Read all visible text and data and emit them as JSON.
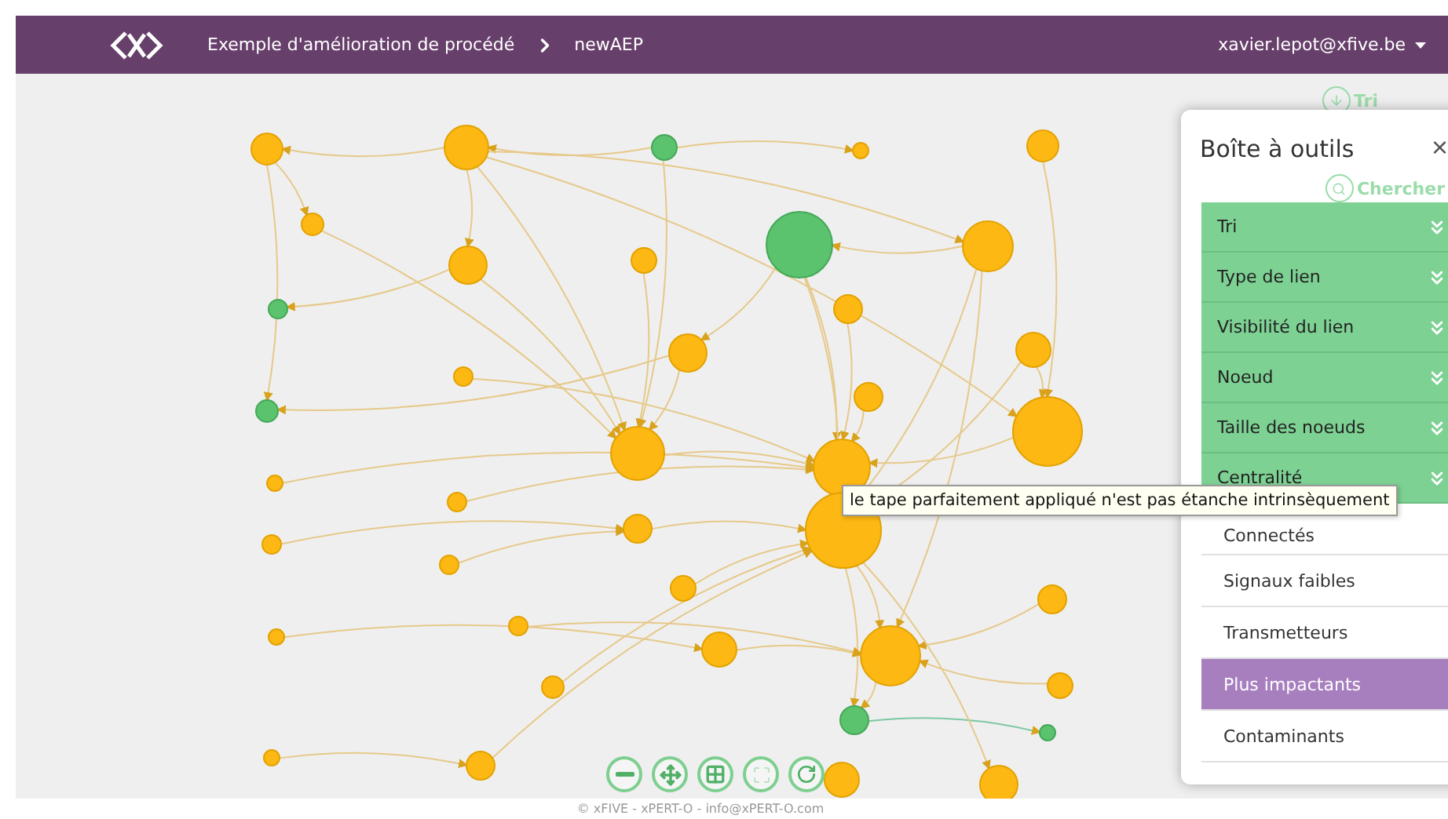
{
  "header": {
    "breadcrumb": [
      "Exemple d'amélioration de procédé",
      "newAEP"
    ],
    "user": "xavier.lepot@xfive.be"
  },
  "toolbox": {
    "sort_label": "Tri",
    "title": "Boîte à outils",
    "close": "×",
    "search_label": "Chercher",
    "sections": [
      {
        "label": "Tri"
      },
      {
        "label": "Type de lien"
      },
      {
        "label": "Visibilité du lien"
      },
      {
        "label": "Noeud"
      },
      {
        "label": "Taille des noeuds"
      },
      {
        "label": "Centralité"
      }
    ],
    "filters": [
      {
        "label": "Connectés",
        "selected": false
      },
      {
        "label": "Signaux faibles",
        "selected": false
      },
      {
        "label": "Transmetteurs",
        "selected": false
      },
      {
        "label": "Plus impactants",
        "selected": true
      },
      {
        "label": "Contaminants",
        "selected": false
      }
    ]
  },
  "tooltip": {
    "text": "le tape parfaitement appliqué n'est pas étanche intrinsèquement"
  },
  "footer": {
    "text": "© xFIVE - xPERT-O - info@xPERT-O.com"
  }
}
